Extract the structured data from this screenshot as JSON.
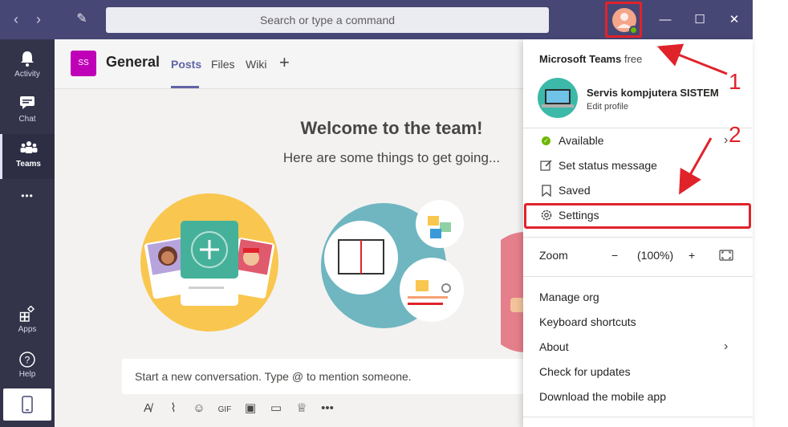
{
  "titlebar": {
    "search_placeholder": "Search or type a command",
    "nav_back": "‹",
    "nav_forward": "›",
    "compose": "✎",
    "minimize": "—",
    "maximize": "☐",
    "close": "✕"
  },
  "appbar": {
    "items": [
      {
        "label": "Activity",
        "icon": "bell-icon",
        "glyph": "🔔"
      },
      {
        "label": "Chat",
        "icon": "chat-icon",
        "glyph": "▤"
      },
      {
        "label": "Teams",
        "icon": "teams-icon",
        "glyph": "⁂"
      },
      {
        "label": "",
        "icon": "more-icon",
        "glyph": "•••"
      },
      {
        "label": "Apps",
        "icon": "apps-icon",
        "glyph": "⊞"
      },
      {
        "label": "Help",
        "icon": "help-icon",
        "glyph": "?"
      }
    ],
    "mobile_glyph": "▯"
  },
  "channel": {
    "team_initials": "SS",
    "title": "General",
    "tabs": [
      "Posts",
      "Files",
      "Wiki"
    ],
    "add_tab": "+"
  },
  "welcome": {
    "title": "Welcome to the team!",
    "subtitle": "Here are some things to get going..."
  },
  "composer": {
    "placeholder": "Start a new conversation. Type @ to mention someone."
  },
  "menu": {
    "brand": "Microsoft Teams",
    "brand_suffix": "free",
    "profile_name": "Servis kompjutera SISTEM",
    "profile_edit": "Edit profile",
    "status": "Available",
    "set_status": "Set status message",
    "saved": "Saved",
    "settings": "Settings",
    "zoom_label": "Zoom",
    "zoom_minus": "−",
    "zoom_value": "(100%)",
    "zoom_plus": "+",
    "manage_org": "Manage org",
    "keyboard_shortcuts": "Keyboard shortcuts",
    "about": "About",
    "check_updates": "Check for updates",
    "download_app": "Download the mobile app"
  },
  "annotations": {
    "step1": "1",
    "step2": "2"
  },
  "colors": {
    "titlebar": "#464775",
    "appbar": "#33344a",
    "accent": "#6264a7",
    "annotation_red": "#e0232b",
    "available_green": "#6bb700"
  }
}
